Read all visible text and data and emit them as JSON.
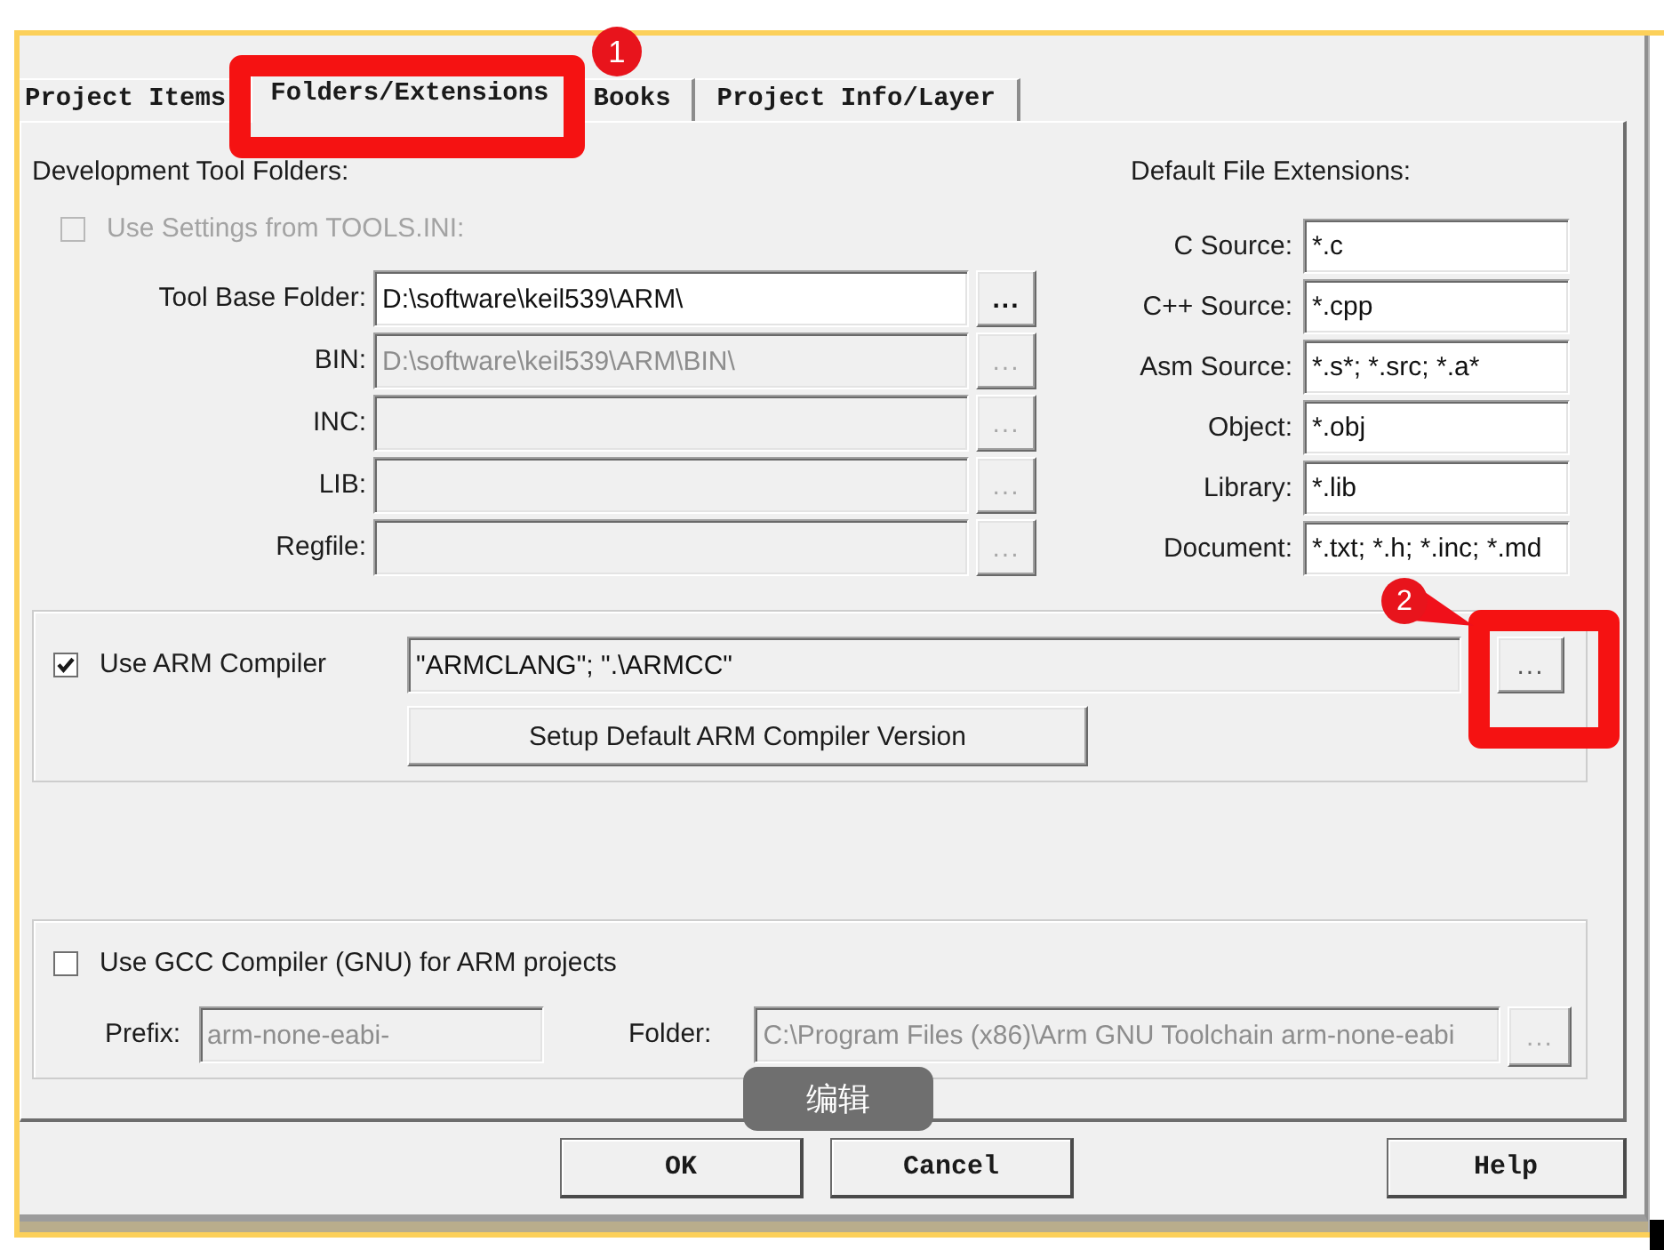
{
  "tabs": [
    {
      "label": "Project Items",
      "selected": false
    },
    {
      "label": "Folders/Extensions",
      "selected": true
    },
    {
      "label": "Books",
      "selected": false
    },
    {
      "label": "Project Info/Layer",
      "selected": false
    }
  ],
  "tool_folders": {
    "title": "Development Tool Folders:",
    "use_tools_ini": {
      "label": "Use Settings from TOOLS.INI:",
      "checked": false,
      "disabled": true
    },
    "rows": [
      {
        "label": "Tool Base Folder:",
        "value": "D:\\software\\keil539\\ARM\\",
        "disabled": false,
        "browse": "..."
      },
      {
        "label": "BIN:",
        "value": "D:\\software\\keil539\\ARM\\BIN\\",
        "disabled": true,
        "browse": "..."
      },
      {
        "label": "INC:",
        "disabled": true,
        "browse": "..."
      },
      {
        "label": "LIB:",
        "disabled": true,
        "browse": "..."
      },
      {
        "label": "Regfile:",
        "disabled": true,
        "browse": "..."
      }
    ]
  },
  "file_extensions": {
    "title": "Default File Extensions:",
    "rows": [
      {
        "label": "C Source:",
        "value": "*.c"
      },
      {
        "label": "C++ Source:",
        "value": "*.cpp"
      },
      {
        "label": "Asm Source:",
        "value": "*.s*; *.src; *.a*"
      },
      {
        "label": "Object:",
        "value": "*.obj"
      },
      {
        "label": "Library:",
        "value": "*.lib"
      },
      {
        "label": "Document:",
        "value": "*.txt; *.h; *.inc; *.md"
      }
    ]
  },
  "arm_compiler": {
    "checkbox": {
      "label": "Use ARM Compiler",
      "checked": true
    },
    "value": "\"ARMCLANG\"; \".\\ARMCC\"",
    "browse": {
      "label": "...",
      "disabled": false
    },
    "setup_button": "Setup Default ARM Compiler Version"
  },
  "gcc_compiler": {
    "checkbox": {
      "label": "Use GCC Compiler (GNU) for ARM projects",
      "checked": false
    },
    "prefix": {
      "label": "Prefix:",
      "value": "arm-none-eabi-",
      "disabled": true
    },
    "folder": {
      "label": "Folder:",
      "value": "C:\\Program Files (x86)\\Arm GNU Toolchain arm-none-eabi",
      "disabled": true
    },
    "browse": {
      "label": "...",
      "disabled": true
    }
  },
  "buttons": [
    {
      "label": "OK"
    },
    {
      "label": "Cancel"
    },
    {
      "label": "Help"
    }
  ],
  "annotations": [
    {
      "number": "1"
    },
    {
      "number": "2"
    }
  ],
  "tooltip": {
    "text": "编辑"
  }
}
